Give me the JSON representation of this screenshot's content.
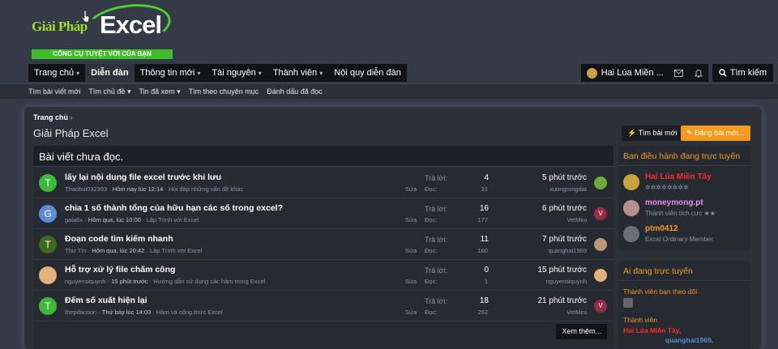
{
  "logo": {
    "text_left": "Giải Pháp",
    "text_right": "Excel",
    "tagline": "CÔNG CỤ TUYỆT VỜI CỦA BẠN"
  },
  "nav": {
    "tabs": [
      {
        "label": "Trang chủ",
        "caret": "▾"
      },
      {
        "label": "Diễn đàn",
        "caret": ""
      },
      {
        "label": "Thông tin mới",
        "caret": "▾"
      },
      {
        "label": "Tài nguyên",
        "caret": "▾"
      },
      {
        "label": "Thành viên",
        "caret": "▾"
      },
      {
        "label": "Nội quy diễn đàn",
        "caret": ""
      }
    ],
    "user_label": "Hai Lúa Miền ...",
    "search_label": "Tìm kiếm"
  },
  "subnav": [
    "Tìm bài viết mới",
    "Tìm chủ đề ▾",
    "Tin đã xem ▾",
    "Tìm theo chuyên mục",
    "Đánh dấu đã đọc"
  ],
  "breadcrumb": "Trang chủ",
  "page_title": "Giải Pháp Excel",
  "buttons": {
    "find_new": "Tìm bài mới",
    "post_new": "Đăng bài mới...",
    "see_more": "Xem thêm..."
  },
  "block_title": "Bài viết chưa đọc.",
  "labels": {
    "replies": "Trả lời:",
    "views": "Đọc:",
    "edit": "Sửa"
  },
  "threads": [
    {
      "avatar": "T",
      "avatar_color": "#3cb83a",
      "title": "lấy lại nội dung file excel trước khi lưu",
      "author": "Thaobui032393",
      "date": "Hôm nay lúc 12:14",
      "forum": "Hỏi đáp những vấn đề khác",
      "replies": "4",
      "views": "31",
      "time": "5 phút trước",
      "last_user": "xuongrongdat",
      "last_avatar": "",
      "last_color": "#6bab3a"
    },
    {
      "avatar": "G",
      "avatar_color": "#5a8fd6",
      "title": "chia 1 số thành tổng của hữu hạn các số trong excel?",
      "author": "gala6x",
      "date": "Hôm qua, lúc 10:00",
      "forum": "Lập Trình với Excel",
      "replies": "16",
      "views": "177",
      "time": "6 phút trước",
      "last_user": "VetMini",
      "last_avatar": "V",
      "last_color": "#9b2a45"
    },
    {
      "avatar": "T",
      "avatar_color": "#3d6a1c",
      "title": "Đoạn code tìm kiếm nhanh",
      "author": "Thư Tín",
      "date": "Hôm qua, lúc 20:42",
      "forum": "Lập Trình với Excel",
      "replies": "11",
      "views": "160",
      "time": "7 phút trước",
      "last_user": "quanghai1969",
      "last_avatar": "",
      "last_color": "#b89a78"
    },
    {
      "avatar": "",
      "avatar_color": "#e2b27a",
      "title": "Hỗ trợ xử lý file chấm công",
      "author": "nguyensiquynh",
      "date": "15 phút trước",
      "forum": "Hướng dẫn sử dụng các hàm trong Excel",
      "replies": "0",
      "views": "1",
      "time": "15 phút trước",
      "last_user": "nguyensiquynh",
      "last_avatar": "",
      "last_color": "#e2b27a"
    },
    {
      "avatar": "T",
      "avatar_color": "#3cb83a",
      "title": "Đếm số xuất hiện lại",
      "author": "thepdaoson",
      "date": "Thứ bảy lúc 14:03",
      "forum": "Hàm và công thức Excel",
      "replies": "18",
      "views": "292",
      "time": "21 phút trước",
      "last_user": "VetMini",
      "last_avatar": "V",
      "last_color": "#9b2a45"
    }
  ],
  "staff": {
    "title": "Ban điều hành đang trực tuyến",
    "members": [
      {
        "name": "Hai Lúa Miền Tây",
        "title": "✲✲✲✲✲✲✲✲",
        "name_color": "#ff2b2b",
        "avatar_color": "#c9a43c"
      },
      {
        "name": "moneymong.pt",
        "title": "Thành viên tích cực ★★",
        "name_color": "#e58ef0",
        "avatar_color": "#b88f8f"
      },
      {
        "name": "ptm0412",
        "title": "Excel Ordinary Member",
        "name_color": "#f39a1f",
        "avatar_color": "#6b6f77"
      }
    ]
  },
  "online": {
    "title": "Ai đang trực tuyến",
    "followed_label": "Thành viên bạn theo dõi",
    "members_label": "Thành viên",
    "members_line": "Hai Lúa Miền Tây, ",
    "members_line2": "quanghai1969,"
  }
}
